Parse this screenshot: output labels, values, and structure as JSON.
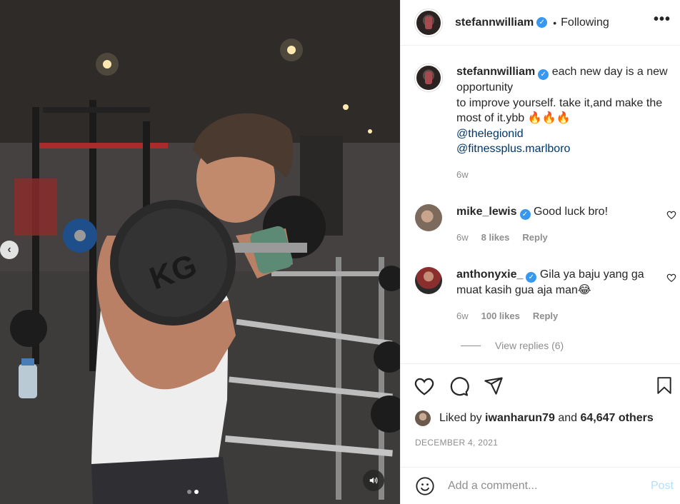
{
  "post": {
    "username": "stefannwilliam",
    "following_label": "Following",
    "more_label": "•••"
  },
  "caption": {
    "username": "stefannwilliam",
    "lines": [
      "each new day is a new",
      "opportunity",
      "to improve yourself. take it,and make the most of it.ybb 🔥🔥🔥"
    ],
    "mentions": [
      "@thelegionid",
      "@fitnessplus.marlboro"
    ],
    "time": "6w"
  },
  "comments": [
    {
      "username": "mike_lewis",
      "text": "Good luck bro!",
      "time": "6w",
      "likes": "8 likes",
      "reply": "Reply"
    },
    {
      "username": "anthonyxie_",
      "text": "Gila ya baju yang ga muat kasih gua aja man😂",
      "time": "6w",
      "likes": "100 likes",
      "reply": "Reply"
    }
  ],
  "view_replies": "View replies (6)",
  "likes": {
    "prefix": "Liked by",
    "user": "iwanharun79",
    "and": "and",
    "others": "64,647 others"
  },
  "date": "DECEMBER 4, 2021",
  "add_comment": {
    "placeholder": "Add a comment...",
    "post_label": "Post"
  },
  "media": {
    "slide_count": 2,
    "active_slide": 2,
    "nav_prev": "‹"
  },
  "icons": {
    "like": "heart-icon",
    "comment": "comment-icon",
    "share": "paper-plane-icon",
    "save": "bookmark-icon",
    "emoji": "emoji-icon",
    "sound": "speaker-icon"
  },
  "colors": {
    "verified": "#3897f0",
    "mention": "#00376b",
    "post_disabled": "#b2dffc",
    "meta": "#8e8e8e"
  }
}
